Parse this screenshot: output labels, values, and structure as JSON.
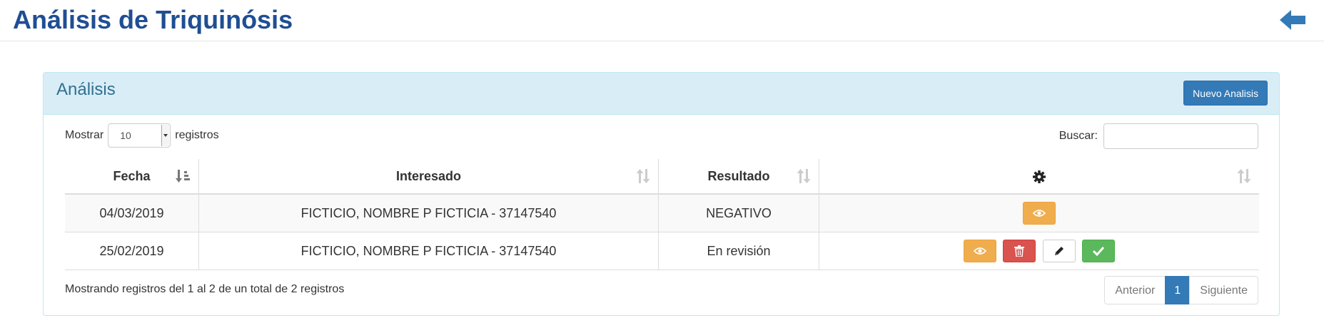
{
  "header": {
    "title": "Análisis de Triquinósis",
    "back_icon": "arrow-left-icon"
  },
  "panel": {
    "title": "Análisis",
    "new_button": "Nuevo Analisis"
  },
  "length": {
    "label_before": "Mostrar",
    "selected": "10",
    "label_after": "registros"
  },
  "search": {
    "label": "Buscar:",
    "value": "",
    "placeholder": ""
  },
  "table": {
    "columns": [
      "Fecha",
      "Interesado",
      "Resultado"
    ],
    "actions_column_icon": "gear-icon",
    "rows": [
      {
        "fecha": "04/03/2019",
        "interesado": "FICTICIO, NOMBRE P FICTICIA - 37147540",
        "resultado": "NEGATIVO",
        "actions": [
          "eye-icon"
        ]
      },
      {
        "fecha": "25/02/2019",
        "interesado": "FICTICIO, NOMBRE P FICTICIA - 37147540",
        "resultado": "En revisión",
        "actions": [
          "eye-icon",
          "trash-icon",
          "pencil-icon",
          "check-icon"
        ]
      }
    ]
  },
  "info": "Mostrando registros del 1 al 2 de un total de 2 registros",
  "pagination": {
    "previous": "Anterior",
    "current": "1",
    "next": "Siguiente"
  },
  "colors": {
    "title": "#1f4e93",
    "panel_heading": "#d9edf7",
    "primary": "#337ab7",
    "warning": "#f0ad4e",
    "danger": "#d9534f",
    "success": "#5cb85c"
  }
}
